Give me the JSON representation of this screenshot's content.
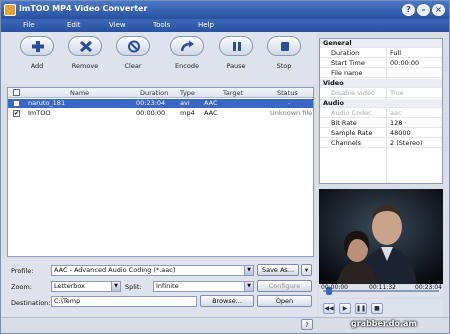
{
  "app": {
    "title": "ImTOO MP4 Video Converter"
  },
  "window_buttons": {
    "help": "?",
    "minimize": "–",
    "close": "×"
  },
  "menu": [
    "File",
    "Edit",
    "View",
    "Tools",
    "Help"
  ],
  "toolbar": [
    {
      "label": "Add",
      "icon": "plus-icon"
    },
    {
      "label": "Remove",
      "icon": "x-icon"
    },
    {
      "label": "Clear",
      "icon": "no-icon"
    },
    {
      "label": "Encode",
      "icon": "encode-arrow-icon"
    },
    {
      "label": "Pause",
      "icon": "pause-icon"
    },
    {
      "label": "Stop",
      "icon": "stop-icon"
    }
  ],
  "file_list": {
    "columns": [
      "Name",
      "Duration",
      "Type",
      "Target",
      "Status"
    ],
    "rows": [
      {
        "checked": false,
        "name": "naruto_181",
        "duration": "00:23:04",
        "type": "avi",
        "target": "AAC",
        "status": "-",
        "selected": true
      },
      {
        "checked": true,
        "name": "ImTOO",
        "duration": "00:00:00",
        "type": "mp4",
        "target": "AAC",
        "status": "Unknown file",
        "selected": false
      }
    ]
  },
  "profile": {
    "label": "Profile:",
    "value": "AAC - Advanced Audio Coding  (*.aac)",
    "save_as": "Save As..."
  },
  "zoom": {
    "label": "Zoom:",
    "value": "Letterbox"
  },
  "split": {
    "label": "Split:",
    "value": "Infinite",
    "configure": "Configure"
  },
  "destination": {
    "label": "Destination:",
    "value": "C:\\Temp",
    "browse": "Browse...",
    "open": "Open"
  },
  "properties": {
    "groups": [
      {
        "name": "General",
        "items": [
          {
            "key": "Duration",
            "value": "Full"
          },
          {
            "key": "Start Time",
            "value": "00:00:00"
          },
          {
            "key": "File name",
            "value": ""
          }
        ]
      },
      {
        "name": "Video",
        "items": [
          {
            "key": "Disable video",
            "value": "True",
            "disabled": true
          }
        ]
      },
      {
        "name": "Audio",
        "items": [
          {
            "key": "Audio Codec",
            "value": "aac",
            "disabled": true
          },
          {
            "key": "Bit Rate",
            "value": "128"
          },
          {
            "key": "Sample Rate",
            "value": "48000"
          },
          {
            "key": "Channels",
            "value": "2 (Stereo)"
          }
        ]
      }
    ]
  },
  "player": {
    "elapsed": "00:00:00",
    "position": "00:11:32",
    "total": "00:23:04",
    "progress": 0.03
  },
  "status_bar": {
    "help": "?"
  },
  "watermark": "grabber.do.am"
}
